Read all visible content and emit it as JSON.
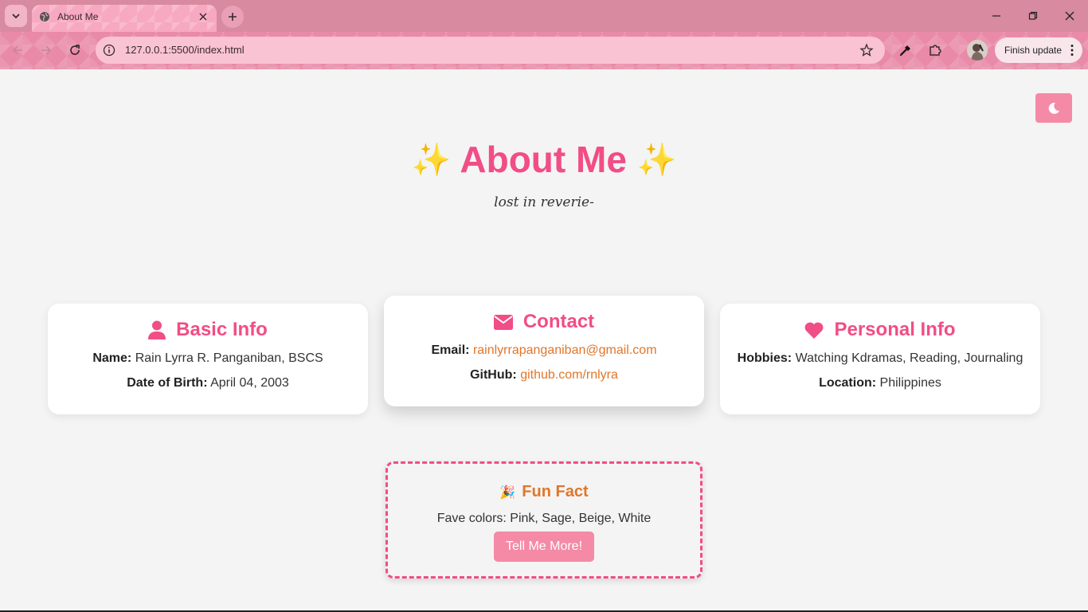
{
  "browser": {
    "tab_title": "About Me",
    "url": "127.0.0.1:5500/index.html",
    "finish_update_label": "Finish update"
  },
  "page": {
    "heading": "About Me",
    "heading_emoji": "✨",
    "tagline": "lost in reverie-",
    "accent_color": "#f14d86",
    "link_color": "#e0762a",
    "button_color": "#f58aa6"
  },
  "cards": {
    "basic": {
      "title": "Basic Info",
      "name_label": "Name:",
      "name_value": "Rain Lyrra R. Panganiban, BSCS",
      "dob_label": "Date of Birth:",
      "dob_value": "April 04, 2003"
    },
    "contact": {
      "title": "Contact",
      "email_label": "Email:",
      "email_value": "rainlyrrapanganiban@gmail.com",
      "github_label": "GitHub:",
      "github_value": "github.com/rnlyra"
    },
    "personal": {
      "title": "Personal Info",
      "hobbies_label": "Hobbies:",
      "hobbies_value": "Watching Kdramas, Reading, Journaling",
      "location_label": "Location:",
      "location_value": "Philippines"
    }
  },
  "fun_fact": {
    "emoji": "🎉",
    "title": "Fun Fact",
    "text": "Fave colors: Pink, Sage, Beige, White",
    "button_label": "Tell Me More!"
  }
}
